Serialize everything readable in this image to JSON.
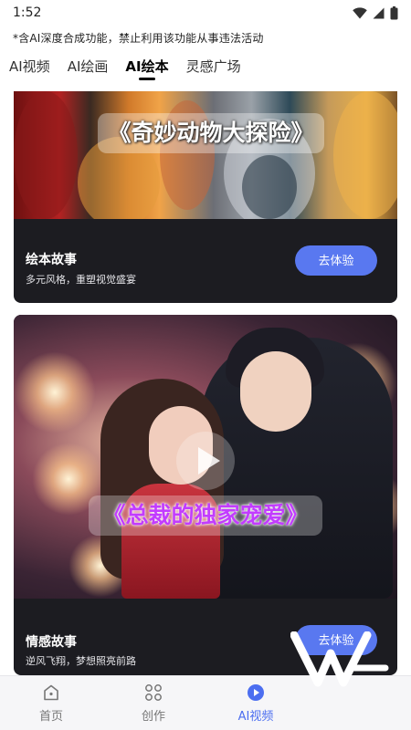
{
  "status_bar": {
    "time": "1:52"
  },
  "notice": "*含AI深度合成功能，禁止利用该功能从事违法活动",
  "tabs": [
    {
      "label": "AI视频",
      "active": false
    },
    {
      "label": "AI绘画",
      "active": false
    },
    {
      "label": "AI绘本",
      "active": true
    },
    {
      "label": "灵感广场",
      "active": false
    }
  ],
  "cards": [
    {
      "image_caption": "《奇妙动物大探险》",
      "title": "绘本故事",
      "subtitle": "多元风格，重塑视觉盛宴",
      "button_label": "去体验"
    },
    {
      "image_caption": "《总裁的独家宠爱》",
      "title": "情感故事",
      "subtitle": "逆风飞翔，梦想照亮前路",
      "button_label": "去体验"
    }
  ],
  "bottom_nav": [
    {
      "label": "首页",
      "icon": "home-icon",
      "active": false
    },
    {
      "label": "创作",
      "icon": "grid-icon",
      "active": false
    },
    {
      "label": "AI视频",
      "icon": "play-circle-icon",
      "active": true
    }
  ],
  "colors": {
    "accent": "#5978f0",
    "card_bg": "#1c1c21",
    "nav_active": "#4c6ef0",
    "caption2": "#c23cff"
  }
}
